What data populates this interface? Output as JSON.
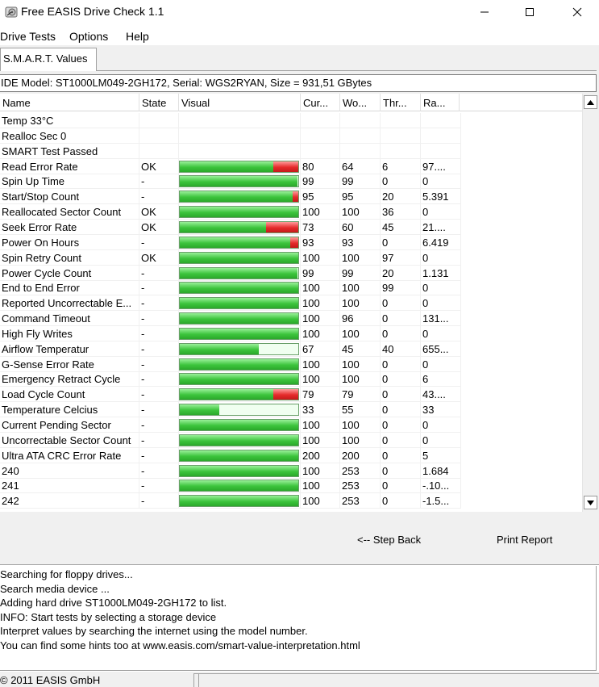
{
  "window": {
    "title": "Free EASIS Drive Check 1.1"
  },
  "menu": {
    "items": [
      "Drive Tests",
      "Options",
      "Help"
    ]
  },
  "tabs": {
    "active_label": "S.M.A.R.T. Values"
  },
  "drive_info": "IDE Model: ST1000LM049-2GH172, Serial: WGS2RYAN, Size = 931,51 GBytes",
  "table": {
    "columns": [
      "Name",
      "State",
      "Visual",
      "Cur...",
      "Wo...",
      "Thr...",
      "Ra..."
    ],
    "rows": [
      {
        "name": "Temp 33°C",
        "state": "",
        "cur": "",
        "worst": "",
        "thr": "",
        "raw": "",
        "bar": null,
        "bar_color": ""
      },
      {
        "name": "Realloc Sec 0",
        "state": "",
        "cur": "",
        "worst": "",
        "thr": "",
        "raw": "",
        "bar": null,
        "bar_color": ""
      },
      {
        "name": "SMART Test Passed",
        "state": "",
        "cur": "",
        "worst": "",
        "thr": "",
        "raw": "",
        "bar": null,
        "bar_color": ""
      },
      {
        "name": "Read Error Rate",
        "state": "OK",
        "cur": "80",
        "worst": "64",
        "thr": "6",
        "raw": "97....",
        "bar": 0.79,
        "bar_color": "red"
      },
      {
        "name": "Spin Up Time",
        "state": "-",
        "cur": "99",
        "worst": "99",
        "thr": "0",
        "raw": "0",
        "bar": 0.99,
        "bar_color": "green"
      },
      {
        "name": "Start/Stop Count",
        "state": "-",
        "cur": "95",
        "worst": "95",
        "thr": "20",
        "raw": "5.391",
        "bar": 0.95,
        "bar_color": "red"
      },
      {
        "name": "Reallocated Sector Count",
        "state": "OK",
        "cur": "100",
        "worst": "100",
        "thr": "36",
        "raw": "0",
        "bar": 1.0,
        "bar_color": "green"
      },
      {
        "name": "Seek Error Rate",
        "state": "OK",
        "cur": "73",
        "worst": "60",
        "thr": "45",
        "raw": "21....",
        "bar": 0.73,
        "bar_color": "red"
      },
      {
        "name": "Power On Hours",
        "state": "-",
        "cur": "93",
        "worst": "93",
        "thr": "0",
        "raw": "6.419",
        "bar": 0.93,
        "bar_color": "red"
      },
      {
        "name": "Spin Retry Count",
        "state": "OK",
        "cur": "100",
        "worst": "100",
        "thr": "97",
        "raw": "0",
        "bar": 1.0,
        "bar_color": "green"
      },
      {
        "name": "Power Cycle Count",
        "state": "-",
        "cur": "99",
        "worst": "99",
        "thr": "20",
        "raw": "1.131",
        "bar": 0.99,
        "bar_color": "green"
      },
      {
        "name": "End to End Error",
        "state": "-",
        "cur": "100",
        "worst": "100",
        "thr": "99",
        "raw": "0",
        "bar": 1.0,
        "bar_color": "green"
      },
      {
        "name": "Reported Uncorrectable E...",
        "state": "-",
        "cur": "100",
        "worst": "100",
        "thr": "0",
        "raw": "0",
        "bar": 1.0,
        "bar_color": "green"
      },
      {
        "name": "Command Timeout",
        "state": "-",
        "cur": "100",
        "worst": "96",
        "thr": "0",
        "raw": "131...",
        "bar": 1.0,
        "bar_color": "green"
      },
      {
        "name": "High Fly Writes",
        "state": "-",
        "cur": "100",
        "worst": "100",
        "thr": "0",
        "raw": "0",
        "bar": 1.0,
        "bar_color": "green"
      },
      {
        "name": "Airflow Temperatur",
        "state": "-",
        "cur": "67",
        "worst": "45",
        "thr": "40",
        "raw": "655...",
        "bar": 0.67,
        "bar_color": "light"
      },
      {
        "name": "G-Sense Error Rate",
        "state": "-",
        "cur": "100",
        "worst": "100",
        "thr": "0",
        "raw": "0",
        "bar": 1.0,
        "bar_color": "green"
      },
      {
        "name": "Emergency Retract Cycle",
        "state": "-",
        "cur": "100",
        "worst": "100",
        "thr": "0",
        "raw": "6",
        "bar": 1.0,
        "bar_color": "green"
      },
      {
        "name": "Load Cycle Count",
        "state": "-",
        "cur": "79",
        "worst": "79",
        "thr": "0",
        "raw": "43....",
        "bar": 0.79,
        "bar_color": "red"
      },
      {
        "name": "Temperature Celcius",
        "state": "-",
        "cur": "33",
        "worst": "55",
        "thr": "0",
        "raw": "33",
        "bar": 0.33,
        "bar_color": "light"
      },
      {
        "name": "Current Pending Sector",
        "state": "-",
        "cur": "100",
        "worst": "100",
        "thr": "0",
        "raw": "0",
        "bar": 1.0,
        "bar_color": "green"
      },
      {
        "name": "Uncorrectable Sector Count",
        "state": "-",
        "cur": "100",
        "worst": "100",
        "thr": "0",
        "raw": "0",
        "bar": 1.0,
        "bar_color": "green"
      },
      {
        "name": "Ultra ATA CRC Error Rate",
        "state": "-",
        "cur": "200",
        "worst": "200",
        "thr": "0",
        "raw": "5",
        "bar": 1.0,
        "bar_color": "green"
      },
      {
        "name": "240",
        "state": "-",
        "cur": "100",
        "worst": "253",
        "thr": "0",
        "raw": "1.684",
        "bar": 1.0,
        "bar_color": "green"
      },
      {
        "name": "241",
        "state": "-",
        "cur": "100",
        "worst": "253",
        "thr": "0",
        "raw": "-.10...",
        "bar": 1.0,
        "bar_color": "green"
      },
      {
        "name": "242",
        "state": "-",
        "cur": "100",
        "worst": "253",
        "thr": "0",
        "raw": "-1.5...",
        "bar": 1.0,
        "bar_color": "green"
      }
    ]
  },
  "actions": {
    "step_back": "<-- Step Back",
    "print_report": "Print Report"
  },
  "log": [
    "Searching for floppy drives...",
    "Search media device ...",
    "Adding hard drive ST1000LM049-2GH172 to list.",
    "INFO: Start tests by selecting a storage device",
    "Interpret values by searching the internet using the model number.",
    "You can find some hints too at www.easis.com/smart-value-interpretation.html"
  ],
  "status": {
    "copyright": "© 2011 EASIS GmbH"
  },
  "colors": {
    "bar_green": "#3cc43c",
    "bar_red": "#e52b2b",
    "bar_empty": "#f0fff0"
  }
}
